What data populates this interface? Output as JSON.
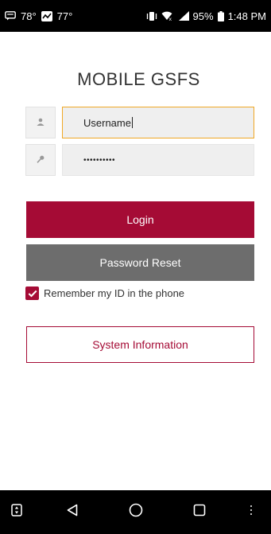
{
  "status_bar": {
    "temp_1": "78°",
    "temp_2": "77°",
    "battery": "95%",
    "time": "1:48 PM",
    "icons": [
      "message-icon",
      "weather-icon",
      "vibrate-icon",
      "wifi-icon",
      "signal-icon",
      "battery-icon"
    ]
  },
  "app": {
    "title": "MOBILE GSFS"
  },
  "login": {
    "username_value": "Username",
    "password_value": "••••••••••",
    "login_label": "Login",
    "reset_label": "Password Reset",
    "remember_label": "Remember my ID in the phone",
    "remember_checked": true,
    "system_info_label": "System Information"
  },
  "nav_bar": {
    "icons": [
      "rotate-icon",
      "back-icon",
      "home-icon",
      "recents-icon",
      "more-icon"
    ]
  },
  "colors": {
    "brand": "#a50b35",
    "reset": "#6d6d6d",
    "focus": "#f0a826"
  }
}
